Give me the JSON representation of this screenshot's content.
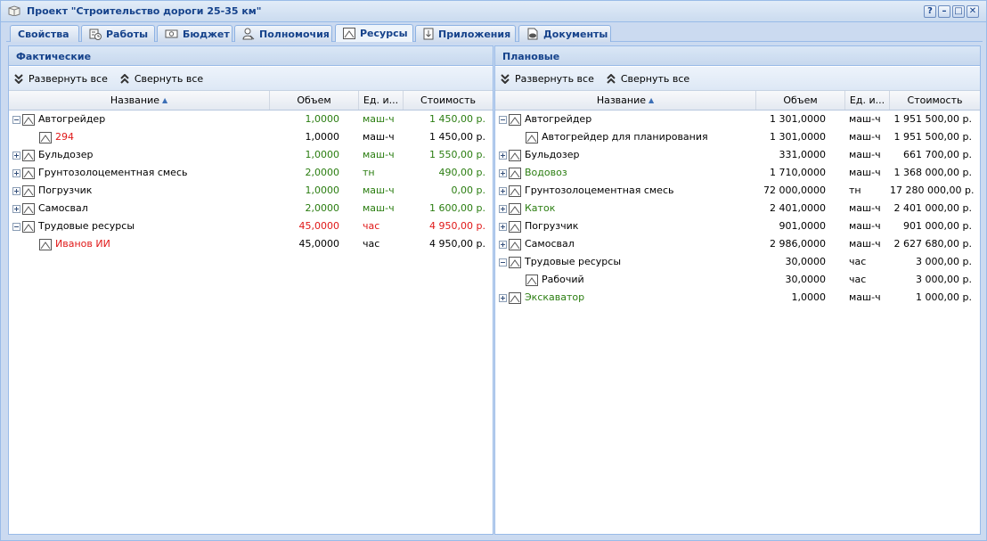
{
  "window": {
    "title": "Проект \"Строительство дороги 25-35 км\"",
    "buttons": [
      "?",
      "–",
      "□",
      "✕"
    ]
  },
  "tabs": [
    {
      "label": "Свойства",
      "icon": "none",
      "active": false
    },
    {
      "label": "Работы",
      "icon": "gantt-icon",
      "active": false
    },
    {
      "label": "Бюджет",
      "icon": "money-icon",
      "active": false
    },
    {
      "label": "Полномочия",
      "icon": "user-key-icon",
      "active": false
    },
    {
      "label": "Ресурсы",
      "icon": "resource-icon",
      "active": true
    },
    {
      "label": "Приложения",
      "icon": "attachment-icon",
      "active": false
    },
    {
      "label": "Документы",
      "icon": "documents-icon",
      "active": false
    }
  ],
  "left_panel": {
    "title": "Фактические",
    "expand_all": "Развернуть все",
    "collapse_all": "Свернуть все",
    "columns": {
      "name": "Название",
      "volume": "Объем",
      "unit": "Ед. и...",
      "cost": "Стоимость"
    },
    "rows": [
      {
        "name": "Автогрейдер",
        "volume": "1,0000",
        "unit": "маш-ч",
        "cost": "1 450,00 р.",
        "level": 0,
        "expander": "minus",
        "name_color": "#000000",
        "value_color": "#2a7d10"
      },
      {
        "name": "294",
        "volume": "1,0000",
        "unit": "маш-ч",
        "cost": "1 450,00 р.",
        "level": 1,
        "expander": "none",
        "name_color": "#e01818",
        "value_color": "#000000"
      },
      {
        "name": "Бульдозер",
        "volume": "1,0000",
        "unit": "маш-ч",
        "cost": "1 550,00 р.",
        "level": 0,
        "expander": "plus",
        "name_color": "#000000",
        "value_color": "#2a7d10"
      },
      {
        "name": "Грунтозолоцементная смесь",
        "volume": "2,0000",
        "unit": "тн",
        "cost": "490,00 р.",
        "level": 0,
        "expander": "plus",
        "name_color": "#000000",
        "value_color": "#2a7d10"
      },
      {
        "name": "Погрузчик",
        "volume": "1,0000",
        "unit": "маш-ч",
        "cost": "0,00 р.",
        "level": 0,
        "expander": "plus",
        "name_color": "#000000",
        "value_color": "#2a7d10"
      },
      {
        "name": "Самосвал",
        "volume": "2,0000",
        "unit": "маш-ч",
        "cost": "1 600,00 р.",
        "level": 0,
        "expander": "plus",
        "name_color": "#000000",
        "value_color": "#2a7d10"
      },
      {
        "name": "Трудовые ресурсы",
        "volume": "45,0000",
        "unit": "час",
        "cost": "4 950,00 р.",
        "level": 0,
        "expander": "minus",
        "name_color": "#000000",
        "value_color": "#e01818"
      },
      {
        "name": "Иванов ИИ",
        "volume": "45,0000",
        "unit": "час",
        "cost": "4 950,00 р.",
        "level": 1,
        "expander": "none",
        "name_color": "#e01818",
        "value_color": "#000000"
      }
    ]
  },
  "right_panel": {
    "title": "Плановые",
    "expand_all": "Развернуть все",
    "collapse_all": "Свернуть все",
    "columns": {
      "name": "Название",
      "volume": "Объем",
      "unit": "Ед. и...",
      "cost": "Стоимость"
    },
    "rows": [
      {
        "name": "Автогрейдер",
        "volume": "1 301,0000",
        "unit": "маш-ч",
        "cost": "1 951 500,00 р.",
        "level": 0,
        "expander": "minus",
        "name_color": "#000000",
        "value_color": "#000000"
      },
      {
        "name": "Автогрейдер для планирования",
        "volume": "1 301,0000",
        "unit": "маш-ч",
        "cost": "1 951 500,00 р.",
        "level": 1,
        "expander": "none",
        "name_color": "#000000",
        "value_color": "#000000"
      },
      {
        "name": "Бульдозер",
        "volume": "331,0000",
        "unit": "маш-ч",
        "cost": "661 700,00 р.",
        "level": 0,
        "expander": "plus",
        "name_color": "#000000",
        "value_color": "#000000"
      },
      {
        "name": "Водовоз",
        "volume": "1 710,0000",
        "unit": "маш-ч",
        "cost": "1 368 000,00 р.",
        "level": 0,
        "expander": "plus",
        "name_color": "#2a7d10",
        "value_color": "#000000"
      },
      {
        "name": "Грунтозолоцементная смесь",
        "volume": "72 000,0000",
        "unit": "тн",
        "cost": "17 280 000,00 р.",
        "level": 0,
        "expander": "plus",
        "name_color": "#000000",
        "value_color": "#000000"
      },
      {
        "name": "Каток",
        "volume": "2 401,0000",
        "unit": "маш-ч",
        "cost": "2 401 000,00 р.",
        "level": 0,
        "expander": "plus",
        "name_color": "#2a7d10",
        "value_color": "#000000"
      },
      {
        "name": "Погрузчик",
        "volume": "901,0000",
        "unit": "маш-ч",
        "cost": "901 000,00 р.",
        "level": 0,
        "expander": "plus",
        "name_color": "#000000",
        "value_color": "#000000"
      },
      {
        "name": "Самосвал",
        "volume": "2 986,0000",
        "unit": "маш-ч",
        "cost": "2 627 680,00 р.",
        "level": 0,
        "expander": "plus",
        "name_color": "#000000",
        "value_color": "#000000"
      },
      {
        "name": "Трудовые ресурсы",
        "volume": "30,0000",
        "unit": "час",
        "cost": "3 000,00 р.",
        "level": 0,
        "expander": "minus",
        "name_color": "#000000",
        "value_color": "#000000"
      },
      {
        "name": "Рабочий",
        "volume": "30,0000",
        "unit": "час",
        "cost": "3 000,00 р.",
        "level": 1,
        "expander": "none",
        "name_color": "#000000",
        "value_color": "#000000"
      },
      {
        "name": "Экскаватор",
        "volume": "1,0000",
        "unit": "маш-ч",
        "cost": "1 000,00 р.",
        "level": 0,
        "expander": "plus",
        "name_color": "#2a7d10",
        "value_color": "#000000"
      }
    ]
  }
}
